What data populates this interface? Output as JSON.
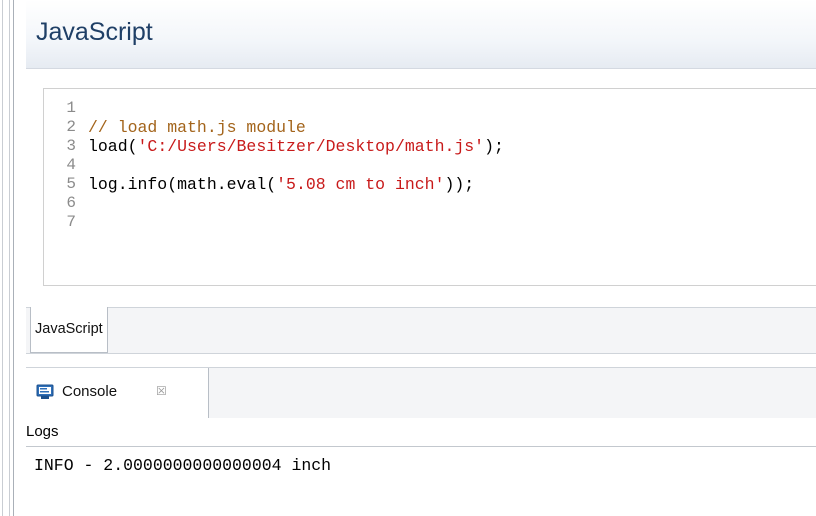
{
  "editor": {
    "title": "JavaScript",
    "line_numbers": [
      "1",
      "2",
      "3",
      "4",
      "5",
      "6",
      "7"
    ],
    "code_lines": [
      {
        "segments": []
      },
      {
        "segments": [
          {
            "text": "// load math.js module",
            "kind": "comment"
          }
        ]
      },
      {
        "segments": [
          {
            "text": "load(",
            "kind": "plain"
          },
          {
            "text": "'C:/Users/Besitzer/Desktop/math.js'",
            "kind": "string"
          },
          {
            "text": ");",
            "kind": "plain"
          }
        ]
      },
      {
        "segments": []
      },
      {
        "segments": [
          {
            "text": "log.info(math.eval(",
            "kind": "plain"
          },
          {
            "text": "'5.08 cm to inch'",
            "kind": "string"
          },
          {
            "text": "));",
            "kind": "plain"
          }
        ]
      },
      {
        "segments": []
      },
      {
        "segments": []
      }
    ],
    "tab_label": "JavaScript"
  },
  "console": {
    "tab_label": "Console",
    "close_glyph": "☒",
    "logs_label": "Logs",
    "output": "INFO - 2.0000000000000004 inch"
  },
  "colors": {
    "title": "#1f3f66",
    "comment": "#a3641b",
    "string": "#c81a1a",
    "line_number": "#8b8b8b"
  },
  "icons": [
    "console-icon",
    "close-icon"
  ]
}
